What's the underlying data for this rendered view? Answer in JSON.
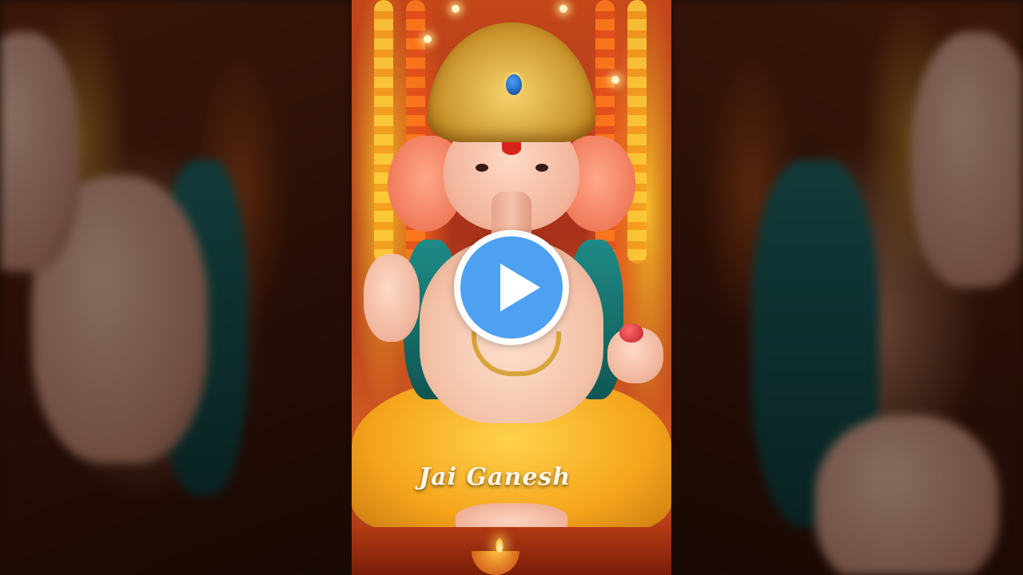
{
  "video": {
    "caption": "Jai Ganesh",
    "state": "paused"
  },
  "controls": {
    "play_button_icon": "play-icon"
  },
  "colors": {
    "play_button_fill": "#4da1f0",
    "play_button_ring": "#ffffff",
    "caption_text": "#fff6e6",
    "garland_yellow": "#ffce3a",
    "garland_orange": "#ff7a1c",
    "drape_teal": "#1f8a86",
    "dhoti_yellow": "#f5a51c"
  }
}
